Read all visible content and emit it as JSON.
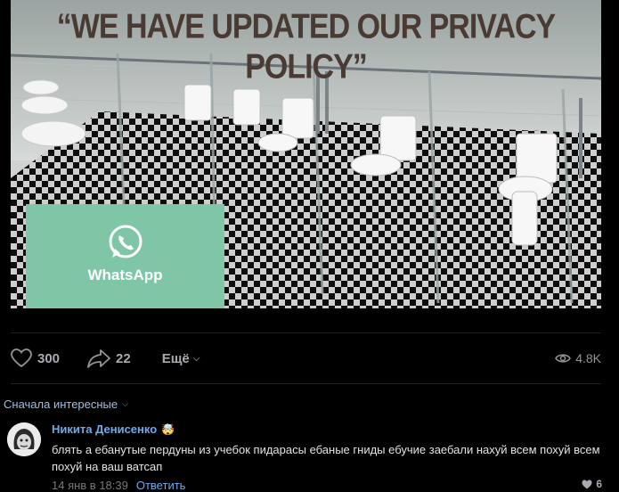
{
  "post": {
    "meme_caption": "“WE HAVE UPDATED OUR PRIVACY POLICY”",
    "whatsapp_label": "WhatsApp"
  },
  "actions": {
    "likes": "300",
    "shares": "22",
    "more_label": "Ещё",
    "views": "4.8K"
  },
  "comments": {
    "sort_label": "Сначала интересные",
    "items": [
      {
        "author": "Никита Денисенко",
        "badge": "🤯",
        "text": "блять а ебанутые пердуны из учебок пидарасы ебаные гниды ебучие заебали нахуй всем похуй всем похуй на ваш ватсап",
        "time": "14 янв в 18:39",
        "reply_label": "Ответить",
        "likes": "6"
      }
    ]
  },
  "colors": {
    "link": "#71aaeb",
    "background": "#000000",
    "whatsapp_green": "#7fc6a7"
  }
}
